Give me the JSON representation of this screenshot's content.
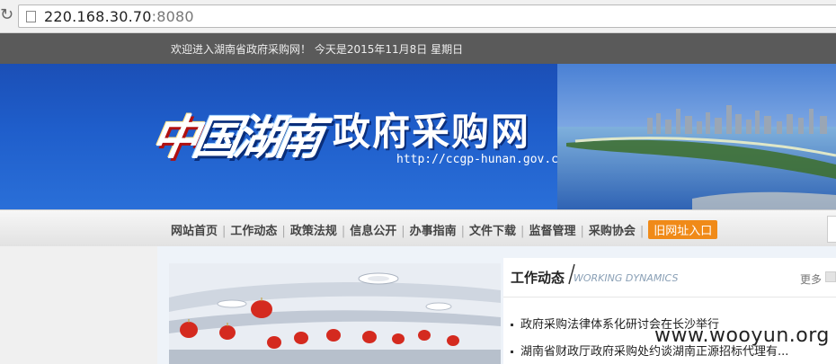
{
  "browser": {
    "url_host": "220.168.30.70",
    "url_port": ":8080"
  },
  "topbar": {
    "welcome": "欢迎进入湖南省政府采购网！  今天是2015年11月8日  星期日"
  },
  "banner": {
    "logo_calligraphy": [
      "中",
      "国",
      "湖",
      "南"
    ],
    "title": "政府采购网",
    "url": "http://ccgp-hunan.gov.cn"
  },
  "nav": {
    "items": [
      "网站首页",
      "工作动态",
      "政策法规",
      "信息公开",
      "办事指南",
      "文件下载",
      "监督管理",
      "采购协会"
    ],
    "old_site": "旧网址入口"
  },
  "panel": {
    "title": "工作动态",
    "subtitle": "WORKING DYNAMICS",
    "more": "更多",
    "news": [
      "政府采购法律体系化研讨会在长沙举行",
      "湖南省财政厅政府采购处约谈湖南正源招标代理有..."
    ]
  },
  "watermark": "www.wooyun.org",
  "colors": {
    "banner_blue": "#1f5ecb",
    "topbar": "#5a5a5a",
    "old_site_orange": "#f08a18"
  }
}
